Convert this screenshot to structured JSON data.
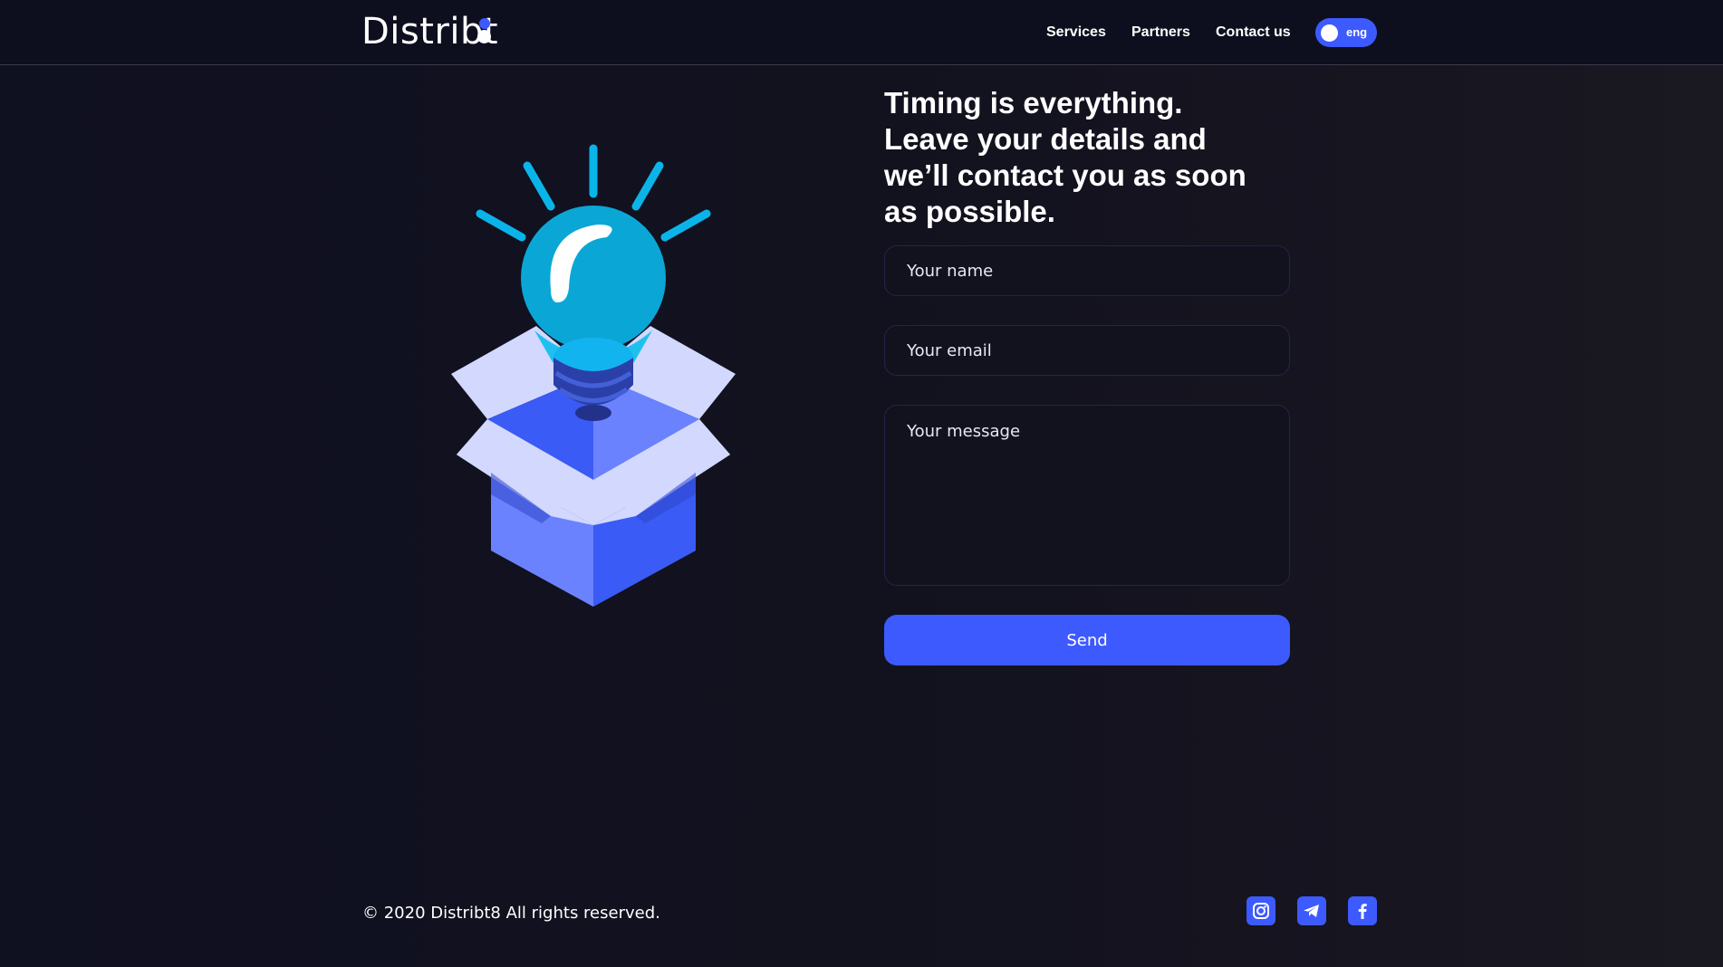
{
  "header": {
    "logo_text": "Distribt",
    "nav": [
      {
        "label": "Services"
      },
      {
        "label": "Partners"
      },
      {
        "label": "Contact us"
      }
    ],
    "language": "eng"
  },
  "contact": {
    "headline": "Timing is everything. Leave your details and we’ll contact you as soon as possible.",
    "name_placeholder": "Your name",
    "email_placeholder": "Your email",
    "message_placeholder": "Your message",
    "send_label": "Send"
  },
  "footer": {
    "copyright": "© 2020 Distribt8 All rights reserved.",
    "social": [
      "instagram-icon",
      "telegram-icon",
      "facebook-icon"
    ]
  },
  "colors": {
    "accent": "#3d5afe",
    "background": "#0f1020",
    "bulb": "#0aa7d6"
  }
}
